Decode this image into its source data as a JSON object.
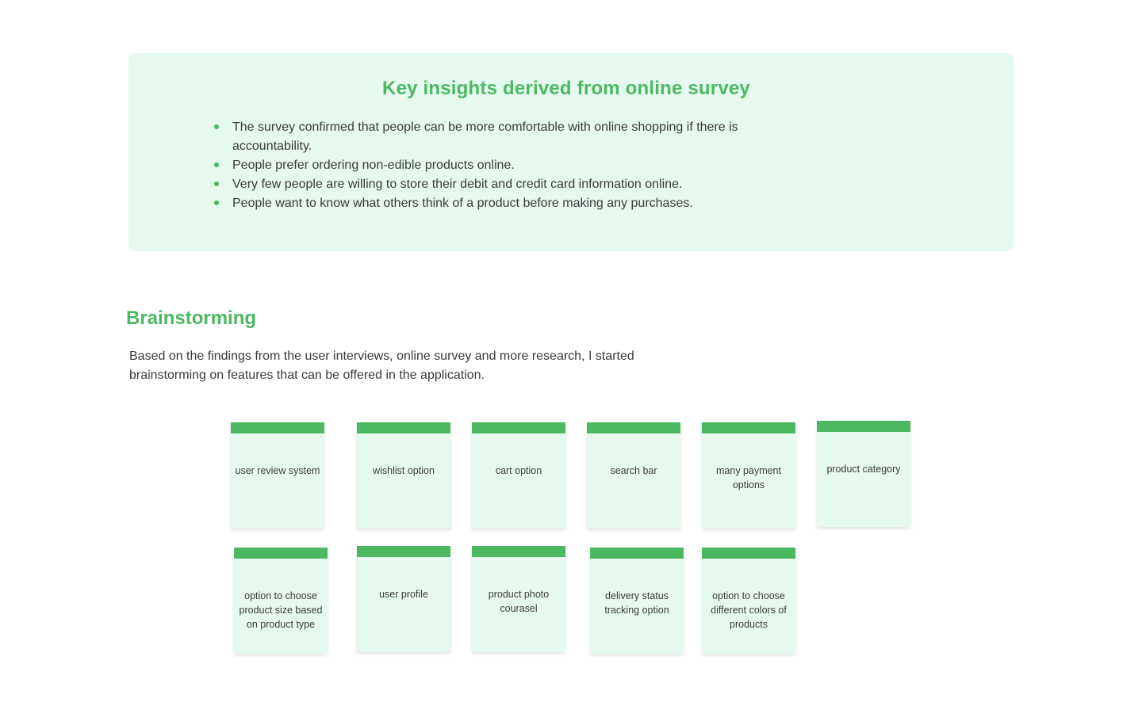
{
  "insights": {
    "title": "Key insights derived from online survey",
    "items": [
      "The survey confirmed that people can be more comfortable with online shopping if there is accountability.",
      "People prefer ordering non-edible products online.",
      "Very few people are willing to store their debit and credit card information online.",
      "People want to know what others think of a product before making any purchases."
    ]
  },
  "brainstorming": {
    "title": "Brainstorming",
    "description": "Based on the findings from the user interviews, online survey and more research, I started brainstorming on features that can be offered in the application.",
    "notes": [
      "user review system",
      "wishlist option",
      "cart option",
      "search bar",
      "many payment options",
      "product category",
      "option to choose product size based on product type",
      "user profile",
      "product photo courasel",
      "delivery status tracking option",
      "option to choose different colors of products"
    ]
  },
  "colors": {
    "accent": "#4cb861",
    "panel_background": "#e6f9ef",
    "body_text": "#3a3a3a"
  }
}
